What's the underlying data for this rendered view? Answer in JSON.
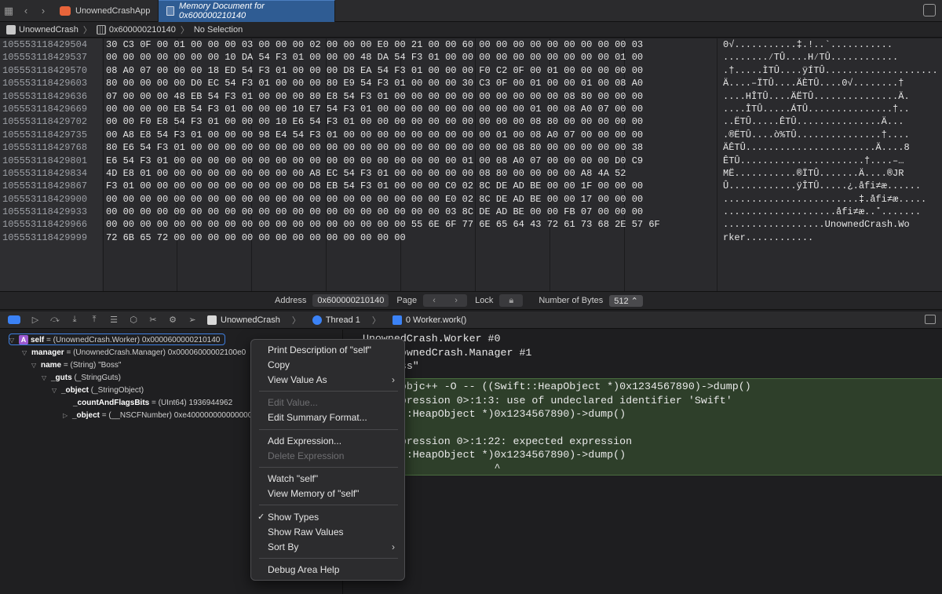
{
  "tabs": [
    {
      "label": "UnownedCrashApp",
      "active": false
    },
    {
      "label": "Memory Document for 0x600000210140",
      "active": true
    }
  ],
  "jumpbar": {
    "project": "UnownedCrash",
    "address": "0x600000210140",
    "selection": "No Selection"
  },
  "memory": {
    "addresses": [
      "105553118429504",
      "105553118429537",
      "105553118429570",
      "105553118429603",
      "105553118429636",
      "105553118429669",
      "105553118429702",
      "105553118429735",
      "105553118429768",
      "105553118429801",
      "105553118429834",
      "105553118429867",
      "105553118429900",
      "105553118429933",
      "105553118429966",
      "105553118429999"
    ],
    "hex": [
      "30 C3 0F 00 01 00 00 00 03 00 00 00 02 00 00 00 E0 00 21 00 00 60 00 00 00 00 00 00 00 00 00 03",
      "00 00 00 00 00 00 00 10 DA 54 F3 01 00 00 00 48 DA 54 F3 01 00 00 00 00 00 00 00 00 00 00 01 00",
      "08 A0 07 00 00 00 18 ED 54 F3 01 00 00 00 D8 EA 54 F3 01 00 00 00 F0 C2 0F 00 01 00 00 00 00 00",
      "80 00 00 00 00 D0 EC 54 F3 01 00 00 00 80 E9 54 F3 01 00 00 00 30 C3 0F 00 01 00 00 01 00 08 A0",
      "07 00 00 00 48 EB 54 F3 01 00 00 00 80 E8 54 F3 01 00 00 00 00 00 00 00 00 00 00 08 80 00 00 00",
      "00 00 00 00 EB 54 F3 01 00 00 00 10 E7 54 F3 01 00 00 00 00 00 00 00 00 00 01 00 08 A0 07 00 00",
      "00 00 F0 E8 54 F3 01 00 00 00 10 E6 54 F3 01 00 00 00 00 00 00 00 00 00 00 08 80 00 00 00 00 00",
      "00 A8 E8 54 F3 01 00 00 00 98 E4 54 F3 01 00 00 00 00 00 00 00 00 00 01 00 08 A0 07 00 00 00 00",
      "80 E6 54 F3 01 00 00 00 00 00 00 00 00 00 00 00 00 00 00 00 00 00 00 00 08 80 00 00 00 00 00 38",
      "E6 54 F3 01 00 00 00 00 00 00 00 00 00 00 00 00 00 00 00 00 00 01 00 08 A0 07 00 00 00 00 D0 C9",
      "4D E8 01 00 00 00 00 00 00 00 00 00 A8 EC 54 F3 01 00 00 00 00 00 08 80 00 00 00 00 A8 4A 52",
      "F3 01 00 00 00 00 00 00 00 00 00 00 D8 EB 54 F3 01 00 00 00 C0 02 8C DE AD BE 00 00 1F 00 00 00",
      "00 00 00 00 00 00 00 00 00 00 00 00 00 00 00 00 00 00 00 00 E0 02 8C DE AD BE 00 00 17 00 00 00",
      "00 00 00 00 00 00 00 00 00 00 00 00 00 00 00 00 00 00 00 00 03 8C DE AD BE 00 00 FB 07 00 00 00",
      "00 00 00 00 00 00 00 00 00 00 00 00 00 00 00 00 00 00 55 6E 6F 77 6E 65 64 43 72 61 73 68 2E 57 6F",
      "72 6B 65 72 00 00 00 00 00 00 00 00 00 00 00 00 00 00"
    ],
    "ascii": [
      "0√...........‡.!..`...........",
      "........⁄TÛ....H⁄TÛ............",
      ".†.....ÌTÛ....ÿÍTÛ....................",
      "Ä....–ÏTÛ....ÄÈTÛ....0√........†",
      "....HÎTÛ....ÄËTÛ...............Ä.",
      "....ÎTÛ.....ÁTÛ...............†..",
      "..ËTÛ.....ÊTÛ...............Ä...",
      ".®ËTÛ....ò%TÛ...............†....",
      "ÄÊTÛ.......................Ä....8",
      "ÊTÛ......................†....–…",
      "MË...........®ÏTÛ.......Ä....®JR",
      "Û............ÿÎTÛ.....¿.åfi≠æ......",
      "........................‡.åfi≠æ.....",
      "....................åfi≠æ..˚.......",
      "..................UnownedCrash.Wo",
      "rker............"
    ]
  },
  "memfooter": {
    "address_label": "Address",
    "address_value": "0x600000210140",
    "page_label": "Page",
    "lock_label": "Lock",
    "bytes_label": "Number of Bytes",
    "bytes_value": "512"
  },
  "debugbar": {
    "crumbs": [
      "UnownedCrash",
      "Thread 1",
      "0 Worker.work()"
    ]
  },
  "variables": [
    {
      "name": "self",
      "rest": " = (UnownedCrash.Worker) 0x0000600000210140",
      "indent": 0
    },
    {
      "name": "manager",
      "rest": " = (UnownedCrash.Manager) 0x00006000002100e0",
      "indent": 1
    },
    {
      "name": "name",
      "rest": " = (String) \"Boss\"",
      "indent": 2
    },
    {
      "name": "_guts",
      "rest": " (_StringGuts)",
      "indent": 3
    },
    {
      "name": "_object",
      "rest": " (_StringObject)",
      "indent": 4
    },
    {
      "name": "_countAndFlagsBits",
      "rest": " = (UInt64) 1936944962",
      "indent": 5
    },
    {
      "name": "_object",
      "rest": " = (__NSCFNumber) 0xe400000000000000",
      "indent": 5
    }
  ],
  "console": {
    "lines": [
      "  UnownedCrash.Worker #0",
      "  er: UnownedCrash.Manager #1",
      "  e: \"Boss\"",
      "  pr -l objc++ -O -- ((Swift::HeapObject *)0x1234567890)->dump()",
      "  ser expression 0>:1:3: use of undeclared identifier 'Swift'",
      "  (Swift::HeapObject *)0x1234567890)->dump()",
      "     ^",
      "  ser expression 0>:1:22: expected expression",
      "  (Swift::HeapObject *)0x1234567890)->dump()",
      "                       ^"
    ]
  },
  "menu": {
    "print_desc": "Print Description of \"self\"",
    "copy": "Copy",
    "view_value_as": "View Value As",
    "edit_value": "Edit Value...",
    "edit_summary": "Edit Summary Format...",
    "add_expression": "Add Expression...",
    "delete_expression": "Delete Expression",
    "watch": "Watch \"self\"",
    "view_memory": "View Memory of \"self\"",
    "show_types": "Show Types",
    "show_raw": "Show Raw Values",
    "sort_by": "Sort By",
    "help": "Debug Area Help"
  },
  "icons": {
    "show_types_check": "checkmark-icon",
    "submenu": "chevron-right-icon"
  }
}
